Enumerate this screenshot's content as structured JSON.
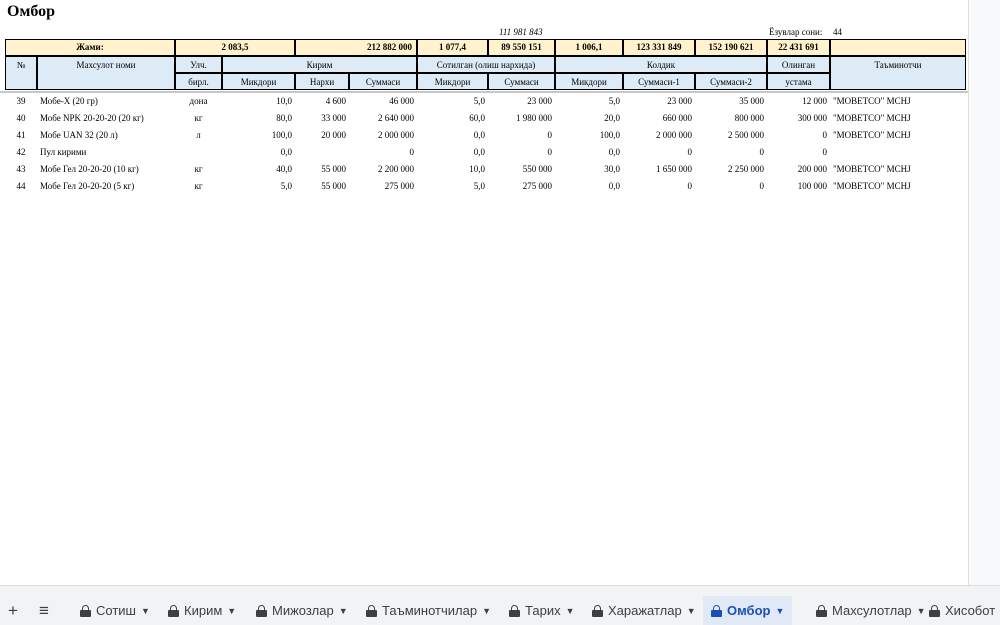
{
  "sheet_title": "Омбор",
  "top_info": {
    "italic_value": "111 981 843",
    "count_label": "Ёзувлар сони:",
    "count_value": "44"
  },
  "totals": {
    "label": "Жами:",
    "t1": "2 083,5",
    "t2": "212 882 000",
    "t3": "1 077,4",
    "t4": "89 550 151",
    "t5": "1 006,1",
    "t6": "123 331 849",
    "t7": "152 190 621",
    "t8": "22 431 691"
  },
  "headers": {
    "no": "№",
    "product": "Махсулот номи",
    "unit1": "Улч.",
    "unit2": "бирл.",
    "kirim": "Кирим",
    "sotilgan": "Сотилган (олиш нархида)",
    "qoldiq": "Колдик",
    "olingan1": "Олинган",
    "olingan2": "устама",
    "supplier": "Таъминотчи",
    "miqdori": "Микдори",
    "narxi": "Нархи",
    "summasi": "Суммаси",
    "summasi1": "Суммаси-1",
    "summasi2": "Суммаси-2"
  },
  "rows": [
    [
      "39",
      "Мобе-X (20 гр)",
      "дона",
      "10,0",
      "4 600",
      "46 000",
      "5,0",
      "23 000",
      "5,0",
      "23 000",
      "35 000",
      "12 000",
      "\"MOBETCO\" MCHJ"
    ],
    [
      "40",
      "Мобе NPK 20-20-20 (20 кг)",
      "кг",
      "80,0",
      "33 000",
      "2 640 000",
      "60,0",
      "1 980 000",
      "20,0",
      "660 000",
      "800 000",
      "300 000",
      "\"MOBETCO\" MCHJ"
    ],
    [
      "41",
      "Мобе UAN 32 (20 л)",
      "л",
      "100,0",
      "20 000",
      "2 000 000",
      "0,0",
      "0",
      "100,0",
      "2 000 000",
      "2 500 000",
      "0",
      "\"MOBETCO\" MCHJ"
    ],
    [
      "42",
      "Пул кирими",
      "",
      "0,0",
      "",
      "0",
      "0,0",
      "0",
      "0,0",
      "0",
      "0",
      "0",
      ""
    ],
    [
      "43",
      "Мобе Гел 20-20-20 (10 кг)",
      "кг",
      "40,0",
      "55 000",
      "2 200 000",
      "10,0",
      "550 000",
      "30,0",
      "1 650 000",
      "2 250 000",
      "200 000",
      "\"MOBETCO\" MCHJ"
    ],
    [
      "44",
      "Мобе Гел 20-20-20 (5 кг)",
      "кг",
      "5,0",
      "55 000",
      "275 000",
      "5,0",
      "275 000",
      "0,0",
      "0",
      "0",
      "100 000",
      "\"MOBETCO\" MCHJ"
    ]
  ],
  "tabs": [
    {
      "label": "Сотиш",
      "active": false
    },
    {
      "label": "Кирим",
      "active": false
    },
    {
      "label": "Мижозлар",
      "active": false
    },
    {
      "label": "Таъминотчилар",
      "active": false
    },
    {
      "label": "Тарих",
      "active": false
    },
    {
      "label": "Харажатлар",
      "active": false
    },
    {
      "label": "Омбор",
      "active": true
    },
    {
      "label": "Махсулотлар",
      "active": false
    },
    {
      "label": "Хисобот",
      "active": false
    }
  ],
  "tab_controls": {
    "add": "+",
    "menu": "≡"
  }
}
